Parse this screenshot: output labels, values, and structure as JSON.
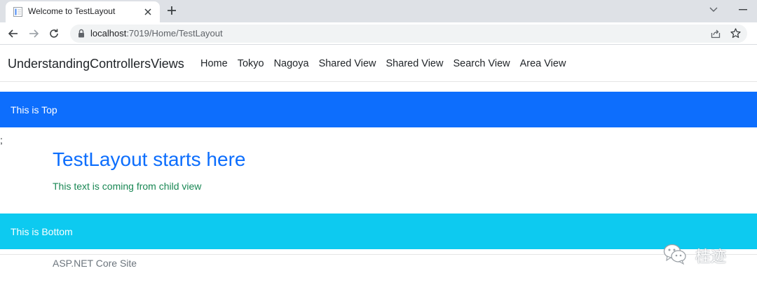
{
  "browser": {
    "tab_title": "Welcome to TestLayout",
    "url_host": "localhost",
    "url_path": ":7019/Home/TestLayout"
  },
  "site": {
    "brand": "UnderstandingControllersViews",
    "nav": [
      "Home",
      "Tokyo",
      "Nagoya",
      "Shared View",
      "Shared View",
      "Search View",
      "Area View"
    ]
  },
  "layout": {
    "top_band": "This is Top",
    "stray_char": ";",
    "heading": "TestLayout starts here",
    "child_text": "This text is coming from child view",
    "bottom_band": "This is Bottom",
    "footer": "ASP.NET Core Site"
  },
  "watermark": {
    "text": "桂迹"
  },
  "colors": {
    "top_band": "#0d6efd",
    "bottom_band": "#0dcaf0",
    "heading": "#0d6efd",
    "child_text": "#198754"
  }
}
